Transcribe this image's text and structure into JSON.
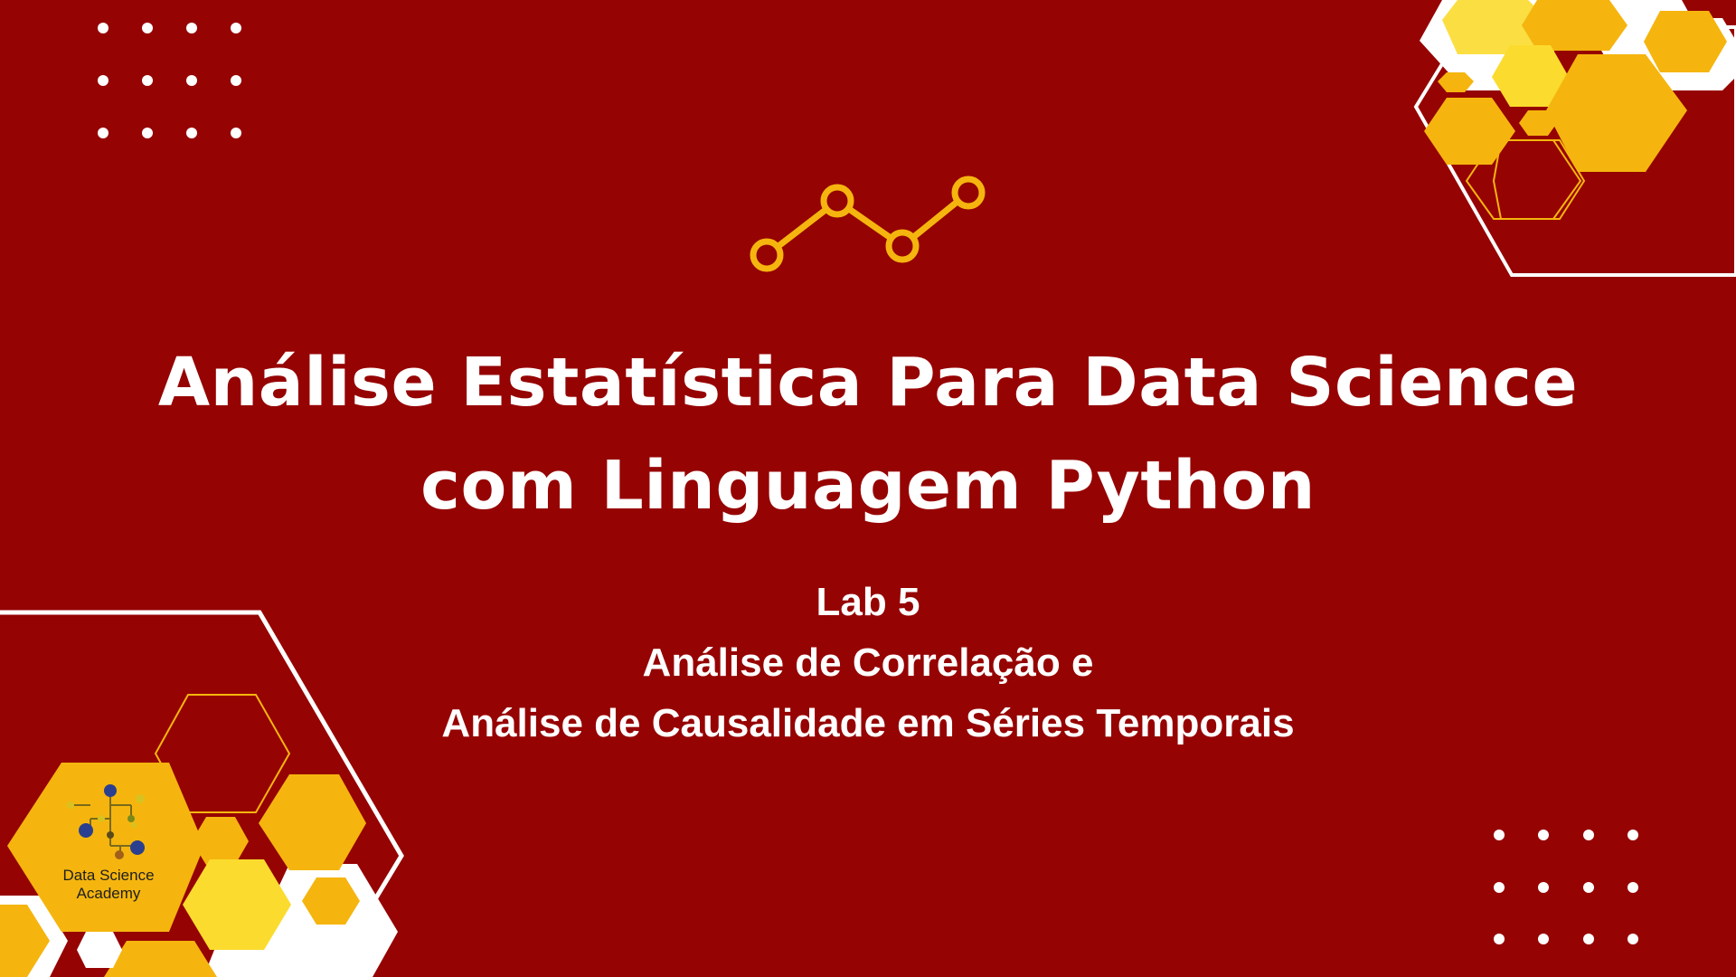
{
  "title": {
    "line1": "Análise Estatística Para Data Science",
    "line2": "com Linguagem Python"
  },
  "subtitle": {
    "lab": "Lab 5",
    "line1": "Análise de Correlação e",
    "line2": "Análise de Causalidade em Séries Temporais"
  },
  "logo": {
    "line1": "Data Science",
    "line2": "Academy"
  },
  "colors": {
    "background": "#960303",
    "accent": "#F5B50E",
    "accent_light": "#FBDB2E",
    "white": "#FFFFFF"
  },
  "icons": {
    "top_center": "line-chart-icon",
    "logo": "network-nodes-icon"
  }
}
